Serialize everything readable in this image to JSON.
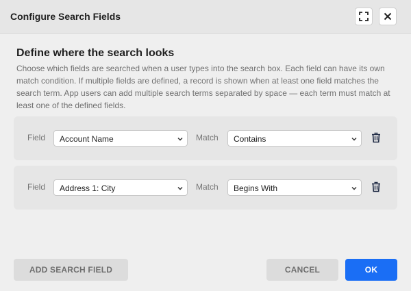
{
  "dialog": {
    "title": "Configure Search Fields"
  },
  "section": {
    "title": "Define where the search looks",
    "description": "Choose which fields are searched when a user types into the search box. Each field can have its own match condition. If multiple fields are defined, a record is shown when at least one field matches the search term. App users can add multiple search terms separated by space — each term must match at least one of the defined fields."
  },
  "labels": {
    "field": "Field",
    "match": "Match"
  },
  "rows": [
    {
      "field": "Account Name",
      "match": "Contains"
    },
    {
      "field": "Address 1: City",
      "match": "Begins With"
    }
  ],
  "footer": {
    "add_label": "ADD SEARCH FIELD",
    "cancel_label": "CANCEL",
    "ok_label": "OK"
  },
  "colors": {
    "primary": "#1a6ef5",
    "header_bg": "#e6e6e6",
    "page_bg": "#efefef"
  }
}
